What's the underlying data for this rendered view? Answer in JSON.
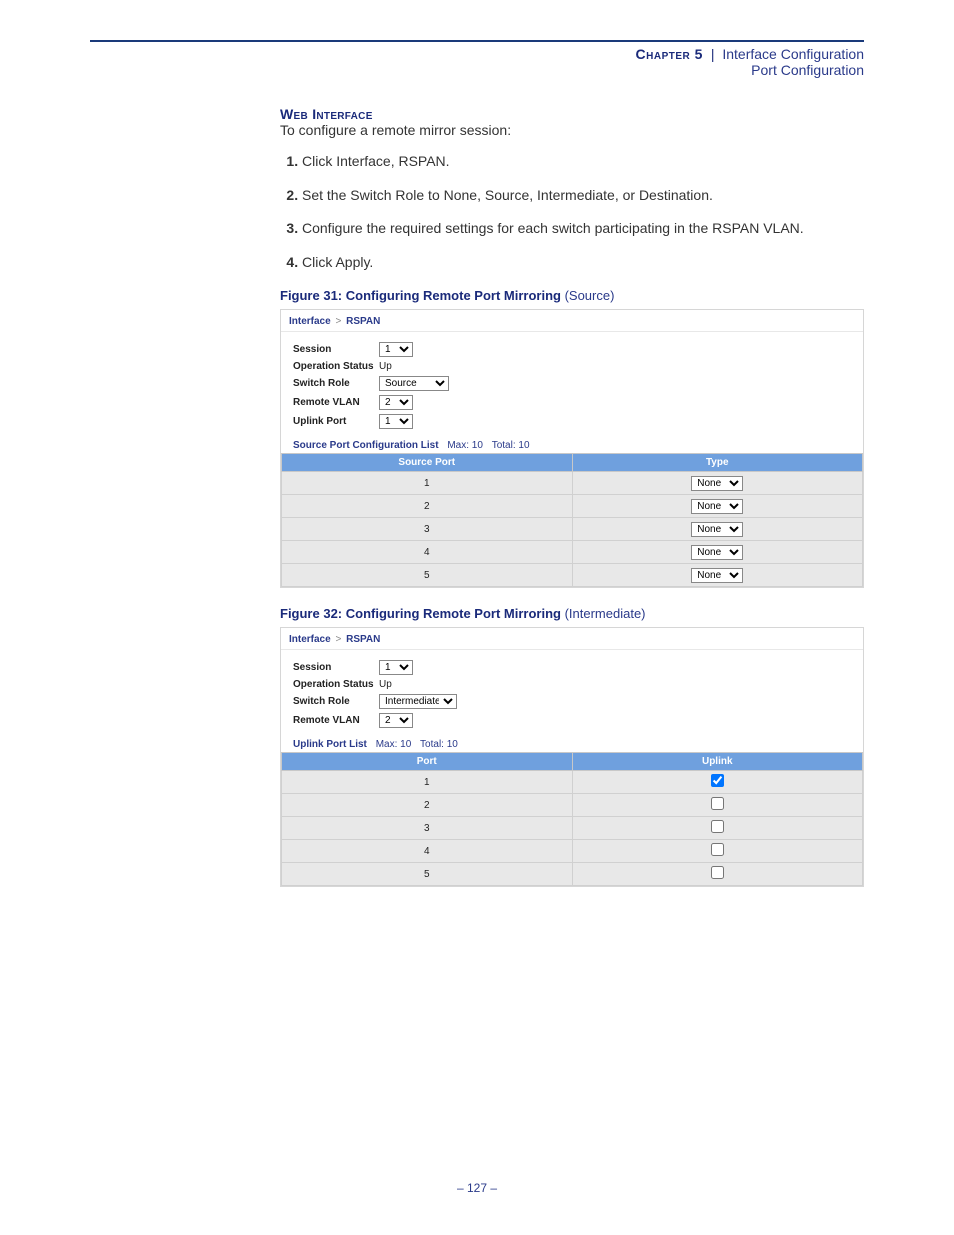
{
  "header": {
    "chapter": "Chapter 5",
    "separator": "|",
    "section": "Interface Configuration",
    "subsection": "Port Configuration"
  },
  "section_heading": "Web Interface",
  "intro": "To configure a remote mirror session:",
  "steps": [
    "Click Interface, RSPAN.",
    "Set the Switch Role to None, Source, Intermediate, or Destination.",
    "Configure the required settings for each switch participating in the RSPAN VLAN.",
    "Click Apply."
  ],
  "figure31": {
    "label": "Figure 31:  Configuring Remote Port Mirroring",
    "variant": "(Source)",
    "breadcrumb_a": "Interface",
    "breadcrumb_b": "RSPAN",
    "fields": {
      "session_label": "Session",
      "session_value": "1",
      "op_status_label": "Operation Status",
      "op_status_value": "Up",
      "switch_role_label": "Switch Role",
      "switch_role_value": "Source",
      "remote_vlan_label": "Remote VLAN",
      "remote_vlan_value": "2",
      "uplink_port_label": "Uplink Port",
      "uplink_port_value": "1"
    },
    "list_title": "Source Port Configuration List",
    "list_max": "Max: 10",
    "list_total": "Total: 10",
    "col_port": "Source Port",
    "col_type": "Type",
    "rows": [
      {
        "port": "1",
        "type": "None"
      },
      {
        "port": "2",
        "type": "None"
      },
      {
        "port": "3",
        "type": "None"
      },
      {
        "port": "4",
        "type": "None"
      },
      {
        "port": "5",
        "type": "None"
      }
    ]
  },
  "figure32": {
    "label": "Figure 32:  Configuring Remote Port Mirroring",
    "variant": "(Intermediate)",
    "breadcrumb_a": "Interface",
    "breadcrumb_b": "RSPAN",
    "fields": {
      "session_label": "Session",
      "session_value": "1",
      "op_status_label": "Operation Status",
      "op_status_value": "Up",
      "switch_role_label": "Switch Role",
      "switch_role_value": "Intermediate",
      "remote_vlan_label": "Remote VLAN",
      "remote_vlan_value": "2"
    },
    "list_title": "Uplink Port List",
    "list_max": "Max: 10",
    "list_total": "Total: 10",
    "col_port": "Port",
    "col_uplink": "Uplink",
    "rows": [
      {
        "port": "1",
        "checked": true
      },
      {
        "port": "2",
        "checked": false
      },
      {
        "port": "3",
        "checked": false
      },
      {
        "port": "4",
        "checked": false
      },
      {
        "port": "5",
        "checked": false
      }
    ]
  },
  "page_number": "–  127  –"
}
